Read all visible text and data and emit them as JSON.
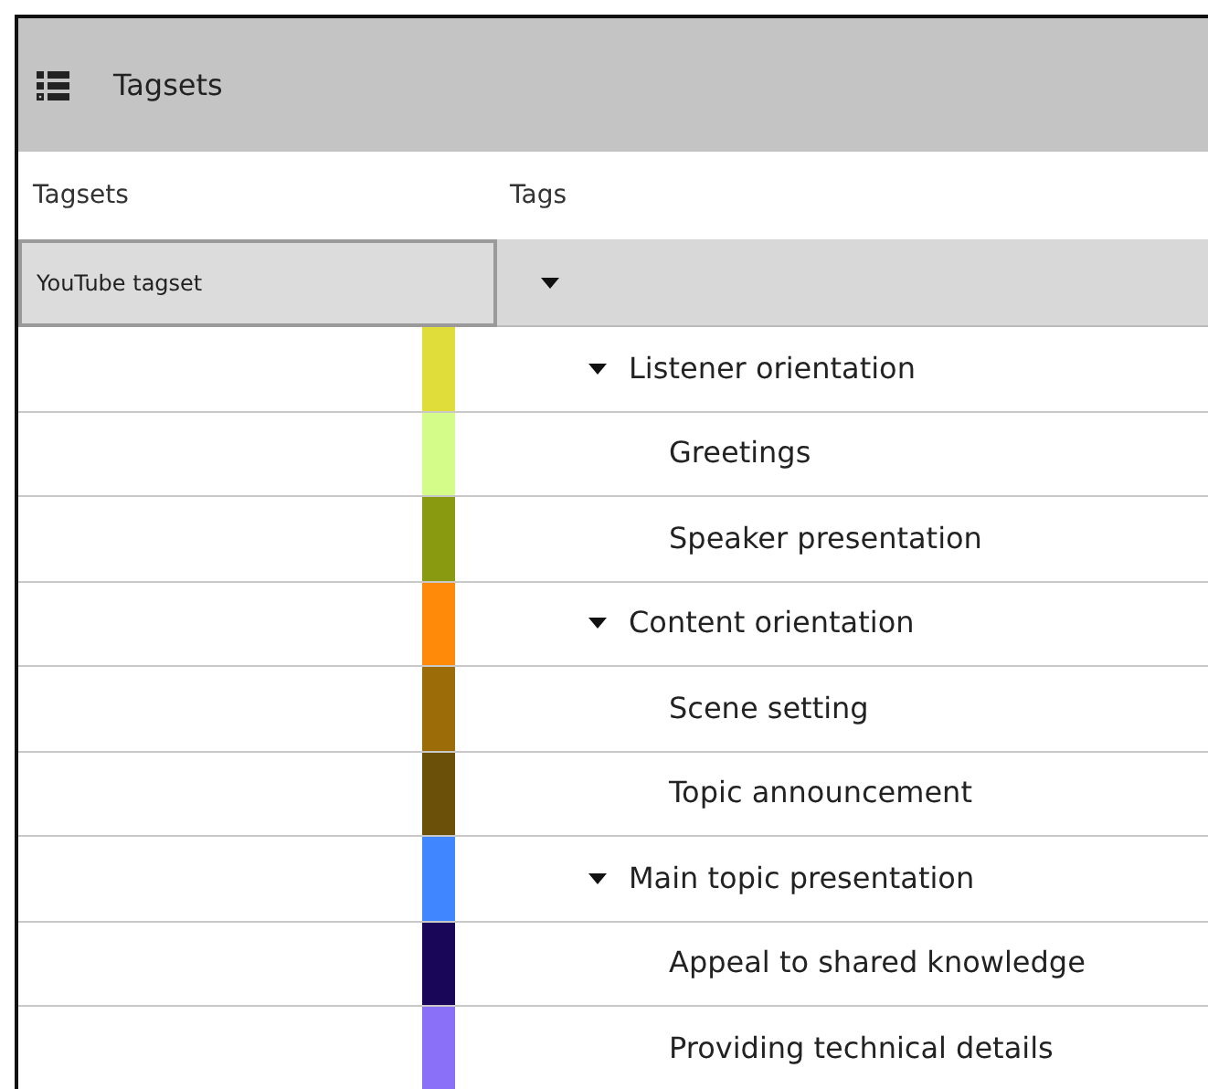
{
  "panel": {
    "title": "Tagsets"
  },
  "columns": [
    "Tagsets",
    "Tags"
  ],
  "tagset": {
    "value": "YouTube tagset"
  },
  "tree": {
    "expanded": true,
    "children": [
      {
        "label": "Listener orientation",
        "color": "#e0dc3a",
        "expanded": true,
        "children": [
          {
            "label": "Greetings",
            "color": "#d4fc88"
          },
          {
            "label": "Speaker presentation",
            "color": "#8a9a10"
          }
        ]
      },
      {
        "label": "Content orientation",
        "color": "#ff8a0a",
        "expanded": true,
        "children": [
          {
            "label": "Scene setting",
            "color": "#9c6c08"
          },
          {
            "label": "Topic announcement",
            "color": "#6a5008"
          }
        ]
      },
      {
        "label": "Main topic presentation",
        "color": "#3f86ff",
        "expanded": true,
        "children": [
          {
            "label": "Appeal to shared knowledge",
            "color": "#1a0658"
          },
          {
            "label": "Providing technical details",
            "color": "#8a70f8"
          }
        ]
      }
    ]
  }
}
